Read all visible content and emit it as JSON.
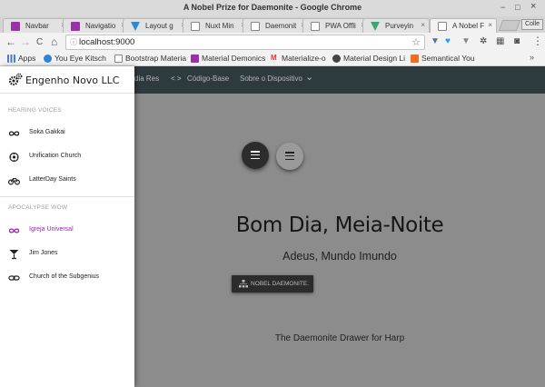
{
  "window": {
    "title": "A Nobel Prize for Daemonite - Google Chrome",
    "minimize": "−",
    "maximize": "□",
    "close": "×"
  },
  "tabs": [
    {
      "label": "Navbar",
      "color": "#9b30a8",
      "active": false
    },
    {
      "label": "Navigatio",
      "color": "#9b30a8",
      "active": false
    },
    {
      "label": "Layout g",
      "color": "#2b8ad8",
      "active": false
    },
    {
      "label": "Nuxt Min",
      "color": "#ffffff",
      "active": false
    },
    {
      "label": "Daemonit",
      "color": "#ffffff",
      "active": false
    },
    {
      "label": "PWA Offli",
      "color": "#ffffff",
      "active": false
    },
    {
      "label": "Purveyin",
      "color": "#3aa676",
      "active": false
    },
    {
      "label": "A Nobel F",
      "color": "#ffffff",
      "active": true
    }
  ],
  "profile_label": "Colle",
  "toolbar": {
    "back": "←",
    "forward": "→",
    "reload": "C",
    "home": "⌂",
    "url": "localhost:9000",
    "star": "☆",
    "menu": "⋮"
  },
  "bookmarks": {
    "apps": "Apps",
    "items": [
      {
        "label": "You Eye Kitsch",
        "color": "#2f84d6"
      },
      {
        "label": "Bootstrap Materia",
        "color": "#ffffff"
      },
      {
        "label": "Material Demonics",
        "color": "#9b30a8"
      },
      {
        "label": "Materialize-o",
        "color": "#e53935"
      },
      {
        "label": "Material Design Li",
        "color": "#444444"
      },
      {
        "label": "Semantical You",
        "color": "#f36c21"
      }
    ],
    "more": "»"
  },
  "appbar": {
    "links": [
      "dia Res",
      "Código-Base",
      "Sobre o Dispositivo"
    ],
    "code_icon": "< >",
    "dropdown": "⌄"
  },
  "sidenav": {
    "brand": "Engenho Novo LLC",
    "sections": [
      {
        "header": "HEARING VOICES",
        "items": [
          {
            "label": "Soka Gakkai",
            "icon": "infinity-icon"
          },
          {
            "label": "Unification Church",
            "icon": "gear-sun-icon"
          },
          {
            "label": "LatterDay Saints",
            "icon": "bicycle-icon"
          }
        ]
      },
      {
        "header": "APOCALYPSE WOW",
        "items": [
          {
            "label": "Igreja Universal",
            "icon": "infinity-icon",
            "active": true
          },
          {
            "label": "Jim Jones",
            "icon": "cocktail-icon"
          },
          {
            "label": "Church of the Subgenius",
            "icon": "link-icon"
          }
        ]
      }
    ]
  },
  "hero": {
    "title": "Bom Dia, Meia-Noite",
    "subtitle": "Adeus, Mundo Imundo",
    "cta": "NOBEL DAEMONITE.",
    "tagline": "The Daemonite Drawer for Harp"
  },
  "colors": {
    "accent": "#9c27b0",
    "appbar": "#2d3a3e",
    "overlay": "#8c8c8c"
  }
}
